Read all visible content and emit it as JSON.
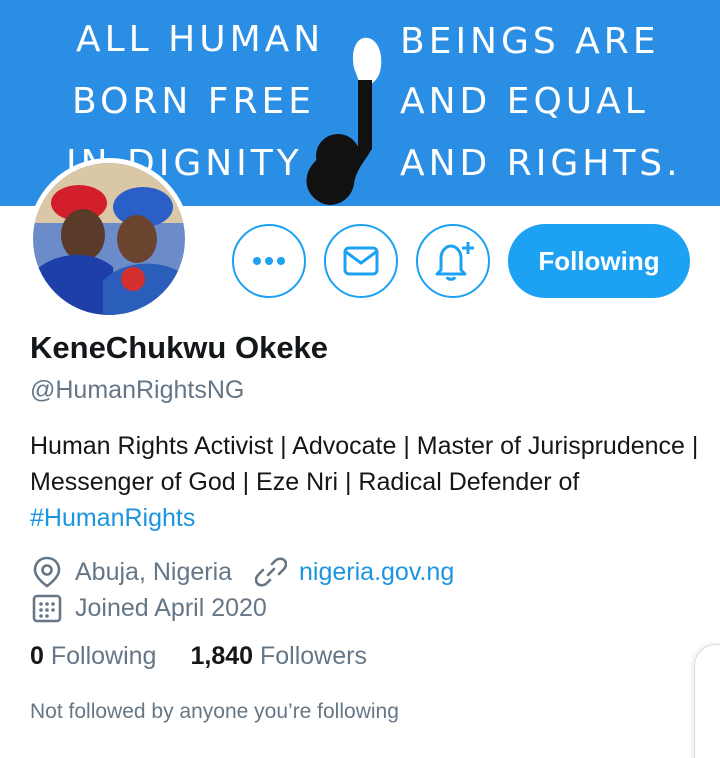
{
  "banner": {
    "lines": [
      "All Human",
      "Beings Are",
      "Born Free",
      "And Equal",
      "in Dignity",
      "And Rights."
    ]
  },
  "profile": {
    "name": "KeneChukwu Okeke",
    "handle": "@HumanRightsNG",
    "bio_text": "Human Rights Activist | Advocate | Master of Jurisprudence | Messenger of God | Eze Nri | Radical Defender of ",
    "bio_hashtag": "#HumanRights",
    "location": "Abuja, Nigeria",
    "website": "nigeria.gov.ng",
    "joined": "Joined April 2020"
  },
  "actions": {
    "follow_label": "Following",
    "icons": [
      "more-icon",
      "mail-icon",
      "bell-plus-icon"
    ]
  },
  "stats": {
    "following_count": "0",
    "following_label": "Following",
    "followers_count": "1,840",
    "followers_label": "Followers"
  },
  "note": "Not followed by anyone you’re following",
  "colors": {
    "accent": "#1da1f2",
    "link": "#1b95e0",
    "banner": "#2a8fe4",
    "muted": "#657786",
    "text": "#14171a"
  }
}
